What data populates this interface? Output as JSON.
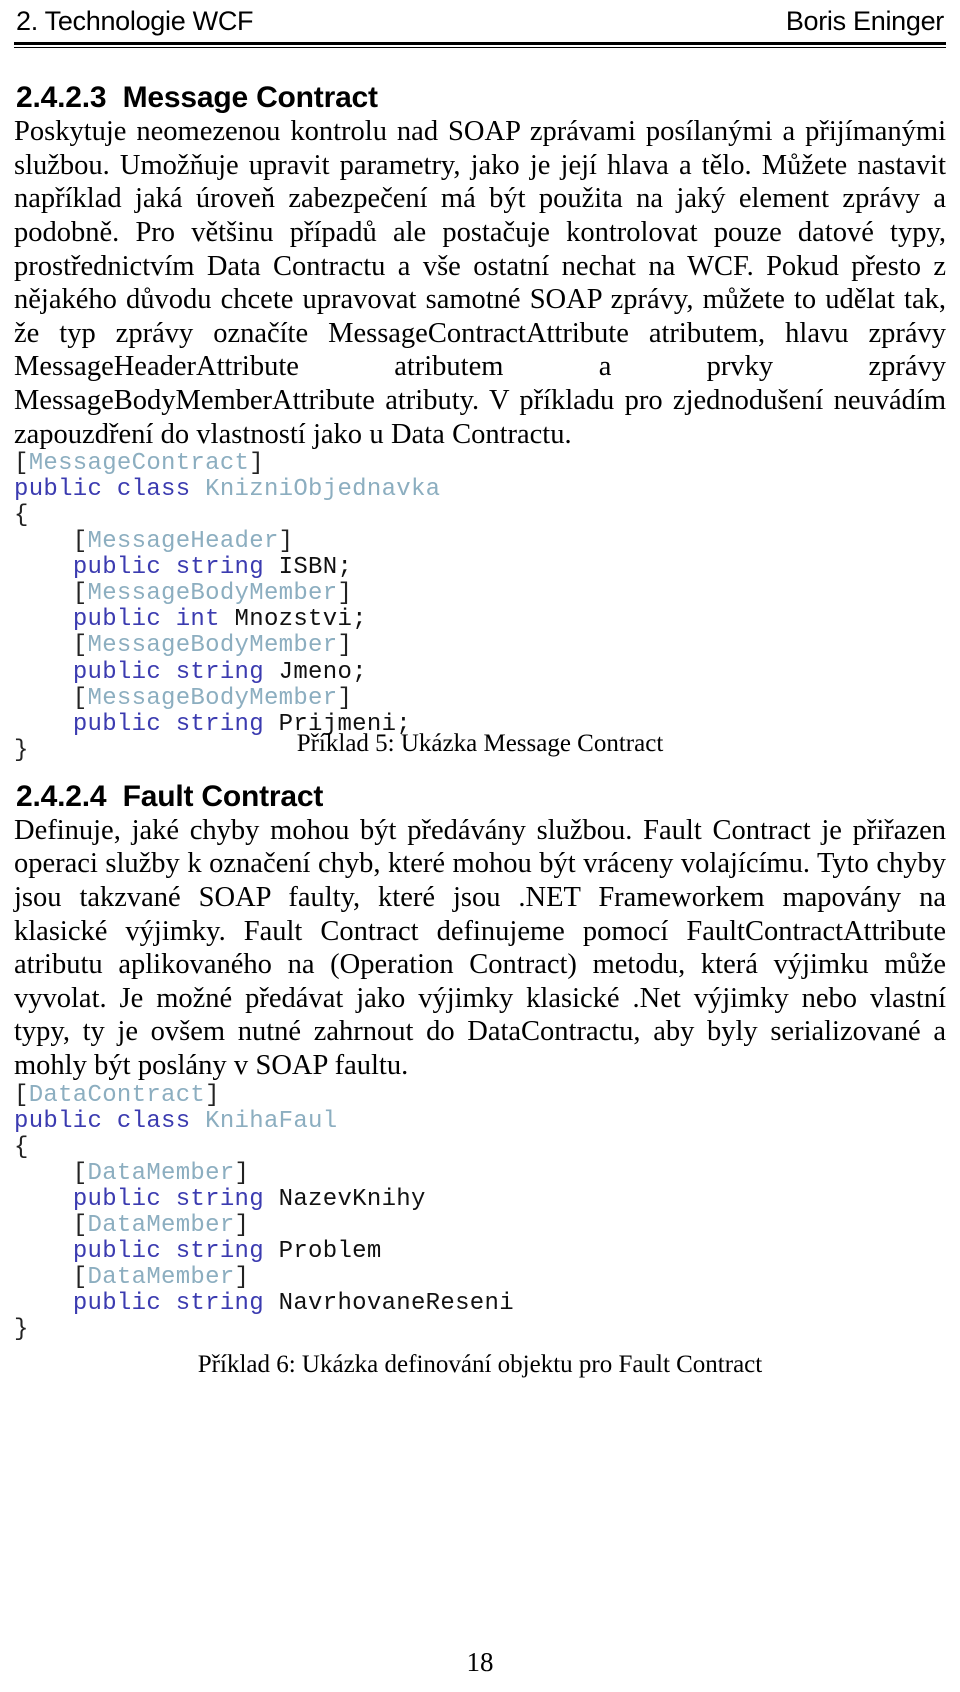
{
  "header": {
    "left": "2. Technologie WCF",
    "right": "Boris Eninger"
  },
  "sections": [
    {
      "number": "2.4.2.3",
      "title": "Message Contract",
      "heading_full": "2.4.2.3  Message Contract",
      "paragraph": "Poskytuje neomezenou kontrolu nad SOAP zprávami posílanými a přijímanými službou. Umožňuje upravit parametry, jako je její hlava a tělo. Můžete nastavit například jaká úroveň zabezpečení má být použita na jaký element zprávy a podobně. Pro většinu případů ale postačuje kontrolovat pouze datové typy, prostřednictvím Data Contractu a vše ostatní nechat na WCF. Pokud přesto z nějakého důvodu chcete upravovat samotné SOAP zprávy, můžete to udělat tak, že typ zprávy označíte MessageContractAttribute atributem, hlavu zprávy MessageHeaderAttribute atributem a prvky zprávy MessageBodyMemberAttribute atributy. V příkladu pro zjednodušení neuvádím zapouzdření do vlastností jako u Data Contractu.",
      "caption": "Příklad 5: Ukázka Message Contract"
    },
    {
      "number": "2.4.2.4",
      "title": "Fault Contract",
      "heading_full": "2.4.2.4  Fault Contract",
      "paragraph": "Definuje, jaké chyby mohou být předávány službou. Fault Contract je přiřazen operaci služby k označení chyb, které mohou být vráceny volajícímu. Tyto chyby jsou takzvané SOAP faulty, které jsou .NET Frameworkem mapovány na klasické výjimky. Fault Contract definujeme pomocí FaultContractAttribute atributu aplikovaného na (Operation Contract) metodu, která výjimku může vyvolat. Je možné předávat jako výjimky klasické .Net výjimky nebo vlastní typy, ty je ovšem nutné zahrnout do DataContractu, aby byly serializované a mohly být poslány v SOAP faultu.",
      "caption": "Příklad 6: Ukázka definování objektu pro Fault Contract"
    }
  ],
  "code_blocks": [
    {
      "id": "message-contract-example",
      "lines": [
        [
          {
            "t": "[",
            "c": "punct"
          },
          {
            "t": "MessageContract",
            "c": "attr"
          },
          {
            "t": "]",
            "c": "punct"
          }
        ],
        [
          {
            "t": "public class ",
            "c": "kw"
          },
          {
            "t": "KnizniObjednavka",
            "c": "type"
          }
        ],
        [
          {
            "t": "{",
            "c": "punct"
          }
        ],
        [
          {
            "t": "    [",
            "c": "punct"
          },
          {
            "t": "MessageHeader",
            "c": "attr"
          },
          {
            "t": "]",
            "c": "punct"
          }
        ],
        [
          {
            "t": "    ",
            "c": "punct"
          },
          {
            "t": "public string ",
            "c": "kw"
          },
          {
            "t": "ISBN;",
            "c": "id"
          }
        ],
        [
          {
            "t": "    [",
            "c": "punct"
          },
          {
            "t": "MessageBodyMember",
            "c": "attr"
          },
          {
            "t": "]",
            "c": "punct"
          }
        ],
        [
          {
            "t": "    ",
            "c": "punct"
          },
          {
            "t": "public int ",
            "c": "kw"
          },
          {
            "t": "Mnozstvi;",
            "c": "id"
          }
        ],
        [
          {
            "t": "    [",
            "c": "punct"
          },
          {
            "t": "MessageBodyMember",
            "c": "attr"
          },
          {
            "t": "]",
            "c": "punct"
          }
        ],
        [
          {
            "t": "    ",
            "c": "punct"
          },
          {
            "t": "public string ",
            "c": "kw"
          },
          {
            "t": "Jmeno;",
            "c": "id"
          }
        ],
        [
          {
            "t": "    [",
            "c": "punct"
          },
          {
            "t": "MessageBodyMember",
            "c": "attr"
          },
          {
            "t": "]",
            "c": "punct"
          }
        ],
        [
          {
            "t": "    ",
            "c": "punct"
          },
          {
            "t": "public string ",
            "c": "kw"
          },
          {
            "t": "Prijmeni;",
            "c": "id"
          }
        ],
        [
          {
            "t": "}",
            "c": "punct"
          }
        ]
      ],
      "plain": "[MessageContract]\npublic class KnizniObjednavka\n{\n    [MessageHeader]\n    public string ISBN;\n    [MessageBodyMember]\n    public int Mnozstvi;\n    [MessageBodyMember]\n    public string Jmeno;\n    [MessageBodyMember]\n    public string Prijmeni;\n}"
    },
    {
      "id": "fault-contract-example",
      "lines": [
        [
          {
            "t": "[",
            "c": "punct"
          },
          {
            "t": "DataContract",
            "c": "attr"
          },
          {
            "t": "]",
            "c": "punct"
          }
        ],
        [
          {
            "t": "public class ",
            "c": "kw"
          },
          {
            "t": "KnihaFaul",
            "c": "type"
          }
        ],
        [
          {
            "t": "{",
            "c": "punct"
          }
        ],
        [
          {
            "t": "    [",
            "c": "punct"
          },
          {
            "t": "DataMember",
            "c": "attr"
          },
          {
            "t": "]",
            "c": "punct"
          }
        ],
        [
          {
            "t": "    ",
            "c": "punct"
          },
          {
            "t": "public string ",
            "c": "kw"
          },
          {
            "t": "NazevKnihy",
            "c": "id"
          }
        ],
        [
          {
            "t": "    [",
            "c": "punct"
          },
          {
            "t": "DataMember",
            "c": "attr"
          },
          {
            "t": "]",
            "c": "punct"
          }
        ],
        [
          {
            "t": "    ",
            "c": "punct"
          },
          {
            "t": "public string ",
            "c": "kw"
          },
          {
            "t": "Problem",
            "c": "id"
          }
        ],
        [
          {
            "t": "    [",
            "c": "punct"
          },
          {
            "t": "DataMember",
            "c": "attr"
          },
          {
            "t": "]",
            "c": "punct"
          }
        ],
        [
          {
            "t": "    ",
            "c": "punct"
          },
          {
            "t": "public string ",
            "c": "kw"
          },
          {
            "t": "NavrhovaneReseni",
            "c": "id"
          }
        ],
        [
          {
            "t": "}",
            "c": "punct"
          }
        ]
      ],
      "plain": "[DataContract]\npublic class KnihaFaul\n{\n    [DataMember]\n    public string NazevKnihy\n    [DataMember]\n    public string Problem\n    [DataMember]\n    public string NavrhovaneReseni\n}"
    }
  ],
  "footer": {
    "page_number": "18"
  },
  "colors": {
    "text": "#000000",
    "code_attribute": "#8CAEC0",
    "code_keyword": "#3B3BB0",
    "code_identifier": "#111111",
    "background": "#ffffff"
  }
}
